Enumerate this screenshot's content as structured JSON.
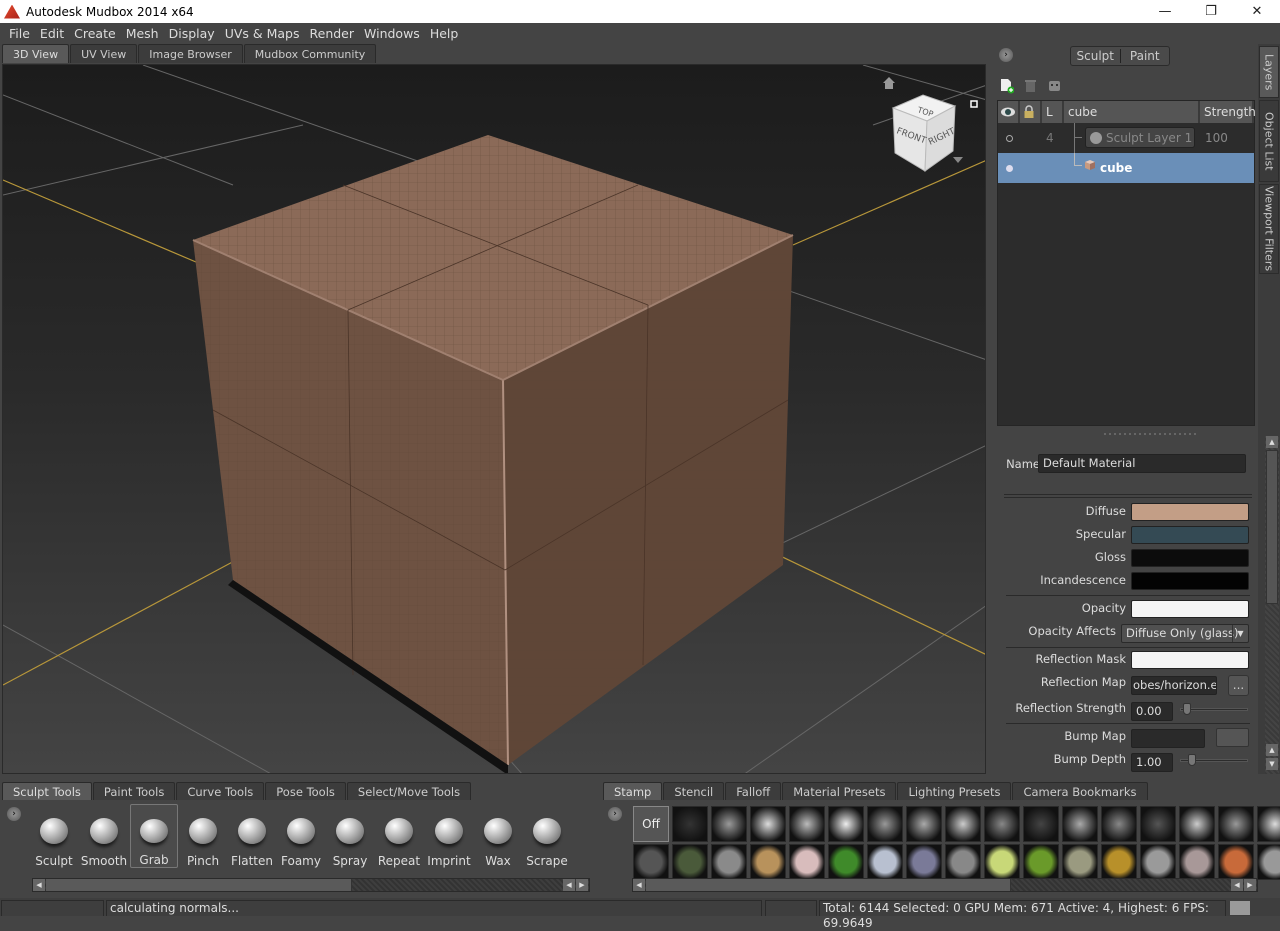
{
  "window": {
    "title": "Autodesk Mudbox 2014 x64",
    "controls": {
      "minimize": "—",
      "restore": "❐",
      "close": "✕"
    }
  },
  "menu": [
    "File",
    "Edit",
    "Create",
    "Mesh",
    "Display",
    "UVs & Maps",
    "Render",
    "Windows",
    "Help"
  ],
  "view_tabs": [
    {
      "label": "3D View",
      "active": true
    },
    {
      "label": "UV View",
      "active": false
    },
    {
      "label": "Image Browser",
      "active": false
    },
    {
      "label": "Mudbox Community",
      "active": false
    }
  ],
  "viewcube": {
    "top": "TOP",
    "front": "FRONT",
    "right": "RIGHT"
  },
  "layers_panel": {
    "mode_toggle": {
      "sculpt": "Sculpt",
      "paint": "Paint",
      "active": "Sculpt"
    },
    "toolbar": [
      "new-layer-icon",
      "delete-layer-icon",
      "mask-icon"
    ],
    "columns": {
      "visible": "eye",
      "lock": "lock",
      "level": "L",
      "name": "cube",
      "strength": "Strength"
    },
    "rows": [
      {
        "level": "4",
        "name": "Sculpt Layer 1",
        "strength": "100",
        "selected": false
      },
      {
        "level": "",
        "name": "cube",
        "strength": "",
        "selected": true
      }
    ]
  },
  "side_tabs": [
    {
      "label": "Layers",
      "active": true
    },
    {
      "label": "Object List",
      "active": false
    },
    {
      "label": "Viewport Filters",
      "active": false
    }
  ],
  "material": {
    "name_label": "Name",
    "name_value": "Default Material",
    "diffuse_label": "Diffuse",
    "diffuse_color": "#c39e86",
    "specular_label": "Specular",
    "specular_color": "#344a54",
    "gloss_label": "Gloss",
    "gloss_color": "#0c0c0c",
    "incandescence_label": "Incandescence",
    "incandescence_color": "#030303",
    "opacity_label": "Opacity",
    "opacity_color": "#f5f5f5",
    "opacity_affects_label": "Opacity Affects",
    "opacity_affects_value": "Diffuse Only (glass)",
    "reflection_mask_label": "Reflection Mask",
    "reflection_mask_color": "#f5f5f5",
    "reflection_map_label": "Reflection Map",
    "reflection_map_value": "obes/horizon.exr",
    "browse_label": "...",
    "reflection_strength_label": "Reflection Strength",
    "reflection_strength_value": "0.00",
    "bump_map_label": "Bump Map",
    "bump_depth_label": "Bump Depth",
    "bump_depth_value": "1.00"
  },
  "tool_tabs": [
    {
      "label": "Sculpt Tools",
      "active": true
    },
    {
      "label": "Paint Tools",
      "active": false
    },
    {
      "label": "Curve Tools",
      "active": false
    },
    {
      "label": "Pose Tools",
      "active": false
    },
    {
      "label": "Select/Move Tools",
      "active": false
    }
  ],
  "tools": [
    {
      "label": "Sculpt",
      "active": false
    },
    {
      "label": "Smooth",
      "active": false
    },
    {
      "label": "Grab",
      "active": true
    },
    {
      "label": "Pinch",
      "active": false
    },
    {
      "label": "Flatten",
      "active": false
    },
    {
      "label": "Foamy",
      "active": false
    },
    {
      "label": "Spray",
      "active": false
    },
    {
      "label": "Repeat",
      "active": false
    },
    {
      "label": "Imprint",
      "active": false
    },
    {
      "label": "Wax",
      "active": false
    },
    {
      "label": "Scrape",
      "active": false
    }
  ],
  "tray_tabs": [
    {
      "label": "Stamp",
      "active": true
    },
    {
      "label": "Stencil",
      "active": false
    },
    {
      "label": "Falloff",
      "active": false
    },
    {
      "label": "Material Presets",
      "active": false
    },
    {
      "label": "Lighting Presets",
      "active": false
    },
    {
      "label": "Camera Bookmarks",
      "active": false
    }
  ],
  "stamps": {
    "off_label": "Off",
    "row1_colors": [
      "#333",
      "#9a9a9a",
      "#ddd",
      "#bbb",
      "#eee",
      "#999",
      "#aaa",
      "#ccc",
      "#888",
      "#444",
      "#aaa",
      "#888",
      "#555",
      "#ccc",
      "#999",
      "#ddd"
    ],
    "row2_colors": [
      "#555",
      "#4a5a3a",
      "#8a8a8a",
      "#b8925c",
      "#d8bcbc",
      "#3f8a2a",
      "#b8c0d0",
      "#7a7a98",
      "#888",
      "#c8d878",
      "#6a9a2a",
      "#9a9a80",
      "#b8902a",
      "#9a9a9a",
      "#a89898",
      "#c86a3a",
      "#999"
    ]
  },
  "status": {
    "message": "calculating normals...",
    "stats": "Total: 6144  Selected: 0 GPU Mem: 671  Active: 4, Highest: 6  FPS: 69.9649"
  }
}
